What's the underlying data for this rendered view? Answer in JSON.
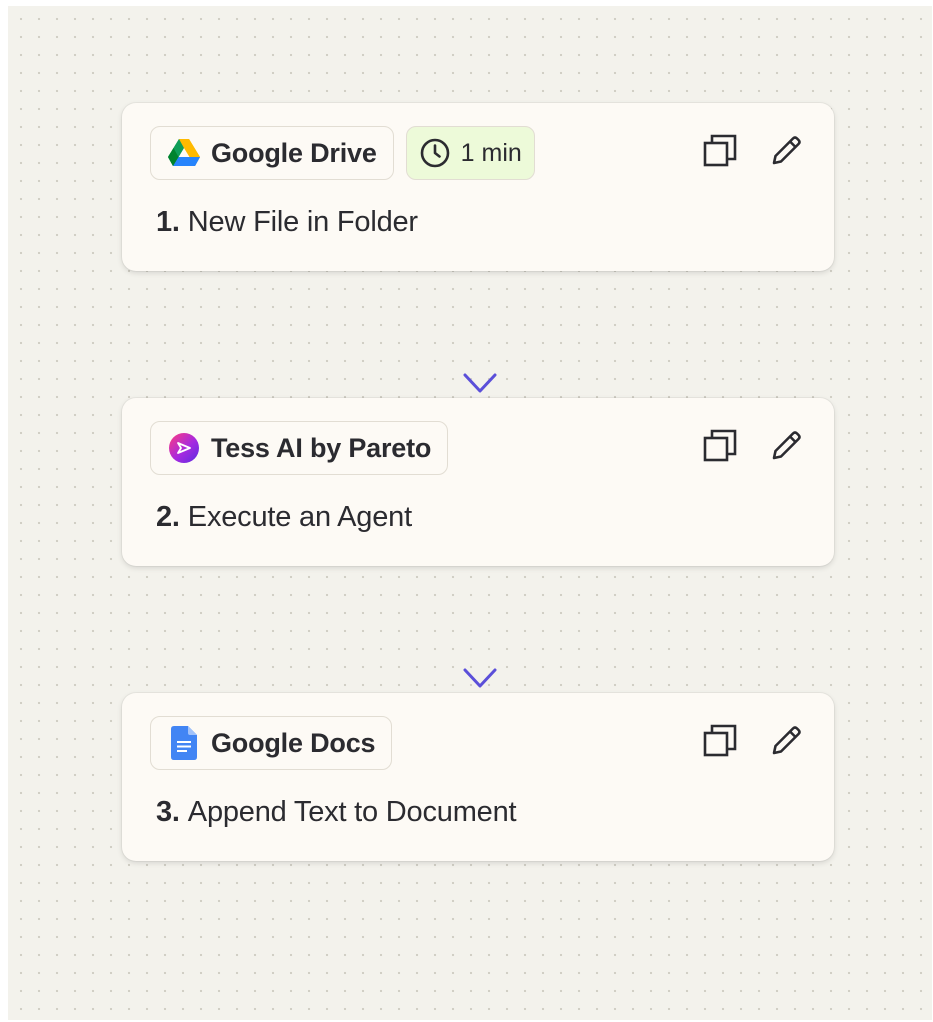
{
  "steps": [
    {
      "app": "Google Drive",
      "app_icon": "google-drive-icon",
      "delay": "1 min",
      "number": "1.",
      "title": "New File in Folder"
    },
    {
      "app": "Tess AI by Pareto",
      "app_icon": "tess-ai-icon",
      "number": "2.",
      "title": "Execute an Agent"
    },
    {
      "app": "Google Docs",
      "app_icon": "google-docs-icon",
      "number": "3.",
      "title": "Append Text to Document"
    }
  ],
  "icons": {
    "duplicate": "copy-icon",
    "edit": "pencil-icon",
    "clock": "clock-icon",
    "connector": "arrow-down-icon"
  },
  "colors": {
    "connector": "#5b4fd9",
    "delay_chip": "#edfad9",
    "card": "#fdfaf5",
    "canvas": "#f3f2ec"
  }
}
